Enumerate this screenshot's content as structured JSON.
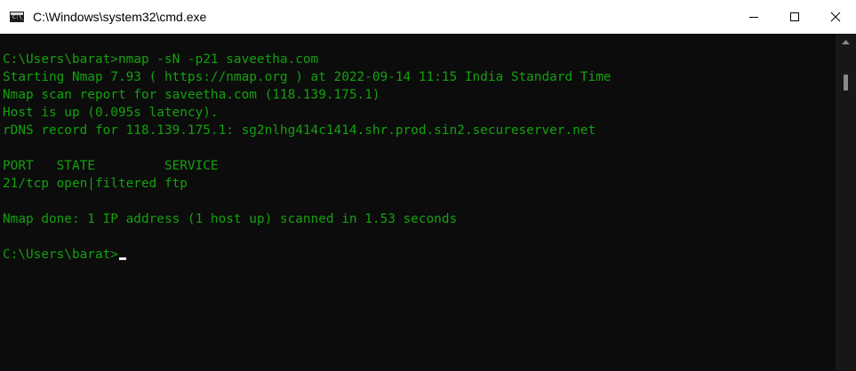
{
  "window": {
    "title": "C:\\Windows\\system32\\cmd.exe",
    "app_icon_text": "C:\\_",
    "controls": [
      "minimize",
      "maximize",
      "close"
    ]
  },
  "terminal": {
    "colors": {
      "text": "#13a10e",
      "background": "#0c0c0c",
      "cursor": "#f2f2f2"
    },
    "lines": [
      "C:\\Users\\barat>nmap -sN -p21 saveetha.com",
      "Starting Nmap 7.93 ( https://nmap.org ) at 2022-09-14 11:15 India Standard Time",
      "Nmap scan report for saveetha.com (118.139.175.1)",
      "Host is up (0.095s latency).",
      "rDNS record for 118.139.175.1: sg2nlhg414c1414.shr.prod.sin2.secureserver.net",
      "",
      "PORT   STATE         SERVICE",
      "21/tcp open|filtered ftp",
      "",
      "Nmap done: 1 IP address (1 host up) scanned in 1.53 seconds",
      "",
      "C:\\Users\\barat>"
    ]
  },
  "icons": {
    "app": "cmd-icon",
    "minimize": "minimize-icon",
    "maximize": "maximize-icon",
    "close": "close-icon",
    "scroll_up": "scroll-up-arrow-icon"
  }
}
